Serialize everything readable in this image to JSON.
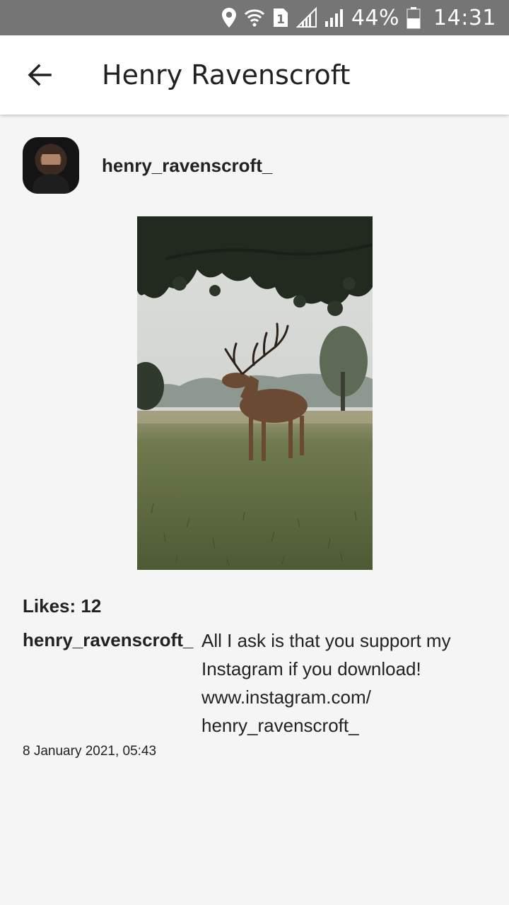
{
  "status_bar": {
    "battery_percent": "44%",
    "sim_badge": "1",
    "time": "14:31",
    "icons": [
      "location-icon",
      "wifi-icon",
      "sim-icon",
      "signal-icon",
      "battery-icon"
    ]
  },
  "app_bar": {
    "title": "Henry Ravenscroft",
    "back_icon": "arrow-left-icon"
  },
  "post": {
    "username": "henry_ravenscroft_",
    "likes": "Likes: 12",
    "caption_user": "henry_ravenscroft_",
    "caption": "All I ask is that you support my Instagram if you download! www.instagram.com/ henry_ravenscroft_",
    "timestamp": "8 January 2021, 05:43"
  }
}
